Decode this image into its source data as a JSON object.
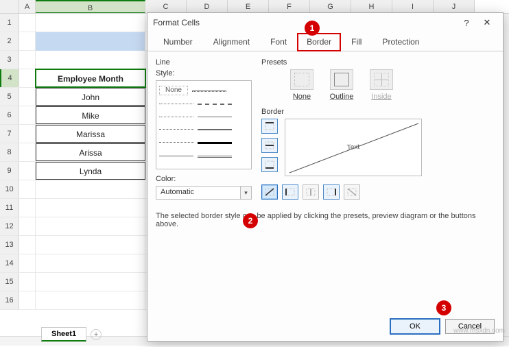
{
  "sheet": {
    "cols": [
      "A",
      "B",
      "C",
      "D",
      "E",
      "F",
      "G",
      "H",
      "I",
      "J"
    ],
    "rowcount": 16,
    "banner_col": "B",
    "header_cell": "Employee Month",
    "data": [
      "John",
      "Mike",
      "Marissa",
      "Arissa",
      "Lynda"
    ],
    "tab_name": "Sheet1"
  },
  "dialog": {
    "title": "Format Cells",
    "help_btn": "?",
    "close_btn": "✕",
    "tabs": [
      "Number",
      "Alignment",
      "Font",
      "Border",
      "Fill",
      "Protection"
    ],
    "active_tab": "Border",
    "line_label": "Line",
    "style_label": "Style:",
    "style_none": "None",
    "color_label": "Color:",
    "color_value": "Automatic",
    "presets_label": "Presets",
    "presets": {
      "none": "None",
      "outline": "Outline",
      "inside": "Inside"
    },
    "border_label": "Border",
    "preview_text": "Text",
    "help_text": "The selected border style can be applied by clicking the presets, preview diagram or the buttons above.",
    "ok": "OK",
    "cancel": "Cancel"
  },
  "callouts": {
    "c1": "1",
    "c2": "2",
    "c3": "3"
  },
  "watermark": "www.msxdn.com"
}
